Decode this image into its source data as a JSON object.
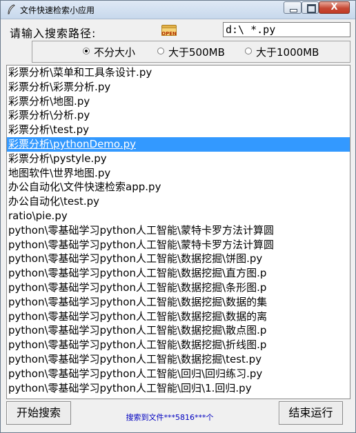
{
  "window": {
    "title": "文件快速检索小应用",
    "close_glyph": "X"
  },
  "search": {
    "path_label": "请输入搜索路径:",
    "open_icon_text": "OPEN",
    "path_value": "d:\\ *.py"
  },
  "size_filter": {
    "options": [
      {
        "label": "不分大小",
        "checked": true
      },
      {
        "label": "大于500MB",
        "checked": false
      },
      {
        "label": "大于1000MB",
        "checked": false
      }
    ]
  },
  "results": [
    "彩票分析\\菜单和工具条设计.py",
    "彩票分析\\彩票分析.py",
    "彩票分析\\地图.py",
    "彩票分析\\分析.py",
    "彩票分析\\test.py",
    "彩票分析\\pythonDemo.py",
    "彩票分析\\pystyle.py",
    "地图软件\\世界地图.py",
    "办公自动化\\文件快速检索app.py",
    "办公自动化\\test.py",
    "ratio\\pie.py",
    "python\\零基础学习python人工智能\\蒙特卡罗方法计算圆",
    "python\\零基础学习python人工智能\\蒙特卡罗方法计算圆",
    "python\\零基础学习python人工智能\\数据挖掘\\饼图.py",
    "python\\零基础学习python人工智能\\数据挖掘\\直方图.p",
    "python\\零基础学习python人工智能\\数据挖掘\\条形图.p",
    "python\\零基础学习python人工智能\\数据挖掘\\数据的集",
    "python\\零基础学习python人工智能\\数据挖掘\\数据的离",
    "python\\零基础学习python人工智能\\数据挖掘\\散点图.p",
    "python\\零基础学习python人工智能\\数据挖掘\\折线图.p",
    "python\\零基础学习python人工智能\\数据挖掘\\test.py",
    "python\\零基础学习python人工智能\\回归\\回归练习.py",
    "python\\零基础学习python人工智能\\回归\\1.回归.py"
  ],
  "selected_index": 5,
  "footer": {
    "start_label": "开始搜索",
    "status": "搜索到文件***5816***个",
    "end_label": "结束运行"
  }
}
